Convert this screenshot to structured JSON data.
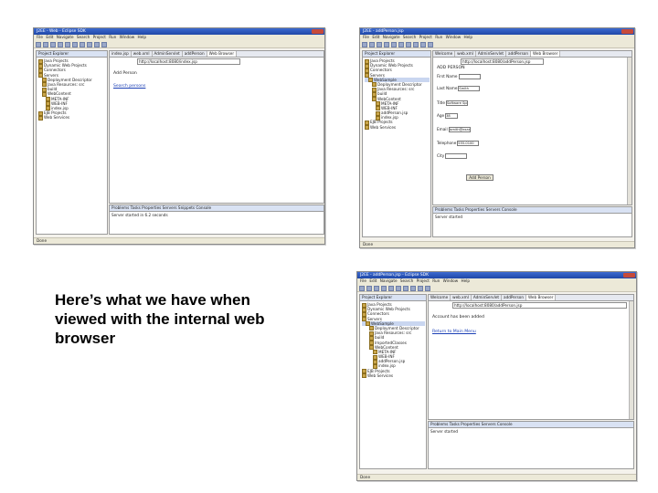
{
  "caption": "Here’s what we have when viewed with the internal web browser",
  "shot_top_left": {
    "title": "J2EE - Web - Eclipse SDK",
    "menu": "File Edit Navigate Search Project Run Window Help",
    "explorer_tab": "Project Explorer",
    "tree": [
      "Java Projects",
      "Dynamic Web Projects",
      "Connectors",
      "Servers",
      "Deployment Descriptor",
      "Java Resources: src",
      "build",
      "WebContent",
      "META-INF",
      "WEB-INF",
      "index.jsp",
      "EJB Projects",
      "Web Services"
    ],
    "editor_tabs": [
      "index.jsp",
      "web.xml",
      "AdminServlet",
      "addPerson",
      "Web Browser"
    ],
    "address": "http://localhost:8080/index.jsp",
    "page_title": "Add Person",
    "page_link": "Search persons",
    "bottom_tabs": "Problems Tasks Properties Servers Snippets Console",
    "console_line": "Server started in 6.2 seconds",
    "status": "Done"
  },
  "shot_top_right": {
    "title": "J2EE - addPerson.jsp",
    "menu": "File Edit Navigate Search Project Run Window Help",
    "explorer_tab": "Project Explorer",
    "tree": [
      "Java Projects",
      "Dynamic Web Projects",
      "Connectors",
      "Servers",
      "WebSample",
      "Deployment Descriptor",
      "Java Resources: src",
      "build",
      "WebContent",
      "META-INF",
      "WEB-INF",
      "addPerson.jsp",
      "index.jsp",
      "EJB Projects",
      "Web Services"
    ],
    "editor_tabs": [
      "Welcome",
      "web.xml",
      "AdminServlet",
      "addPerson",
      "Web Browser"
    ],
    "address": "http://localhost:8080/addPerson.jsp",
    "form_heading": "ADD PERSON",
    "fields": [
      {
        "label": "First Name",
        "value": ""
      },
      {
        "label": "Last Name",
        "value": "Smith"
      },
      {
        "label": "Title",
        "value": "Software Specialist"
      },
      {
        "label": "Age",
        "value": "38"
      },
      {
        "label": "Email",
        "value": "jsmith@example.com"
      },
      {
        "label": "Telephone",
        "value": "555-0100"
      },
      {
        "label": "City",
        "value": ""
      }
    ],
    "submit": "Add Person",
    "bottom_tabs": "Problems Tasks Properties Servers Console",
    "console_line": "Server started",
    "status": "Done"
  },
  "shot_bottom_right": {
    "title": "J2EE - addPerson.jsp - Eclipse SDK",
    "menu": "File Edit Navigate Search Project Run Window Help",
    "explorer_tab": "Project Explorer",
    "tree": [
      "Java Projects",
      "Dynamic Web Projects",
      "Connectors",
      "Servers",
      "WebSample",
      "Deployment Descriptor",
      "Java Resources: src",
      "build",
      "ImportedClasses",
      "WebContent",
      "META-INF",
      "WEB-INF",
      "addPerson.jsp",
      "index.jsp",
      "EJB Projects",
      "Web Services"
    ],
    "editor_tabs": [
      "Welcome",
      "web.xml",
      "AdminServlet",
      "addPerson",
      "Web Browser"
    ],
    "address": "http://localhost:8080/addPerson.jsp",
    "message": "Account has been added",
    "page_link": "Return to Main Menu",
    "bottom_tabs": "Problems Tasks Properties Servers Console",
    "console_line": "Server started",
    "status": "Done"
  }
}
